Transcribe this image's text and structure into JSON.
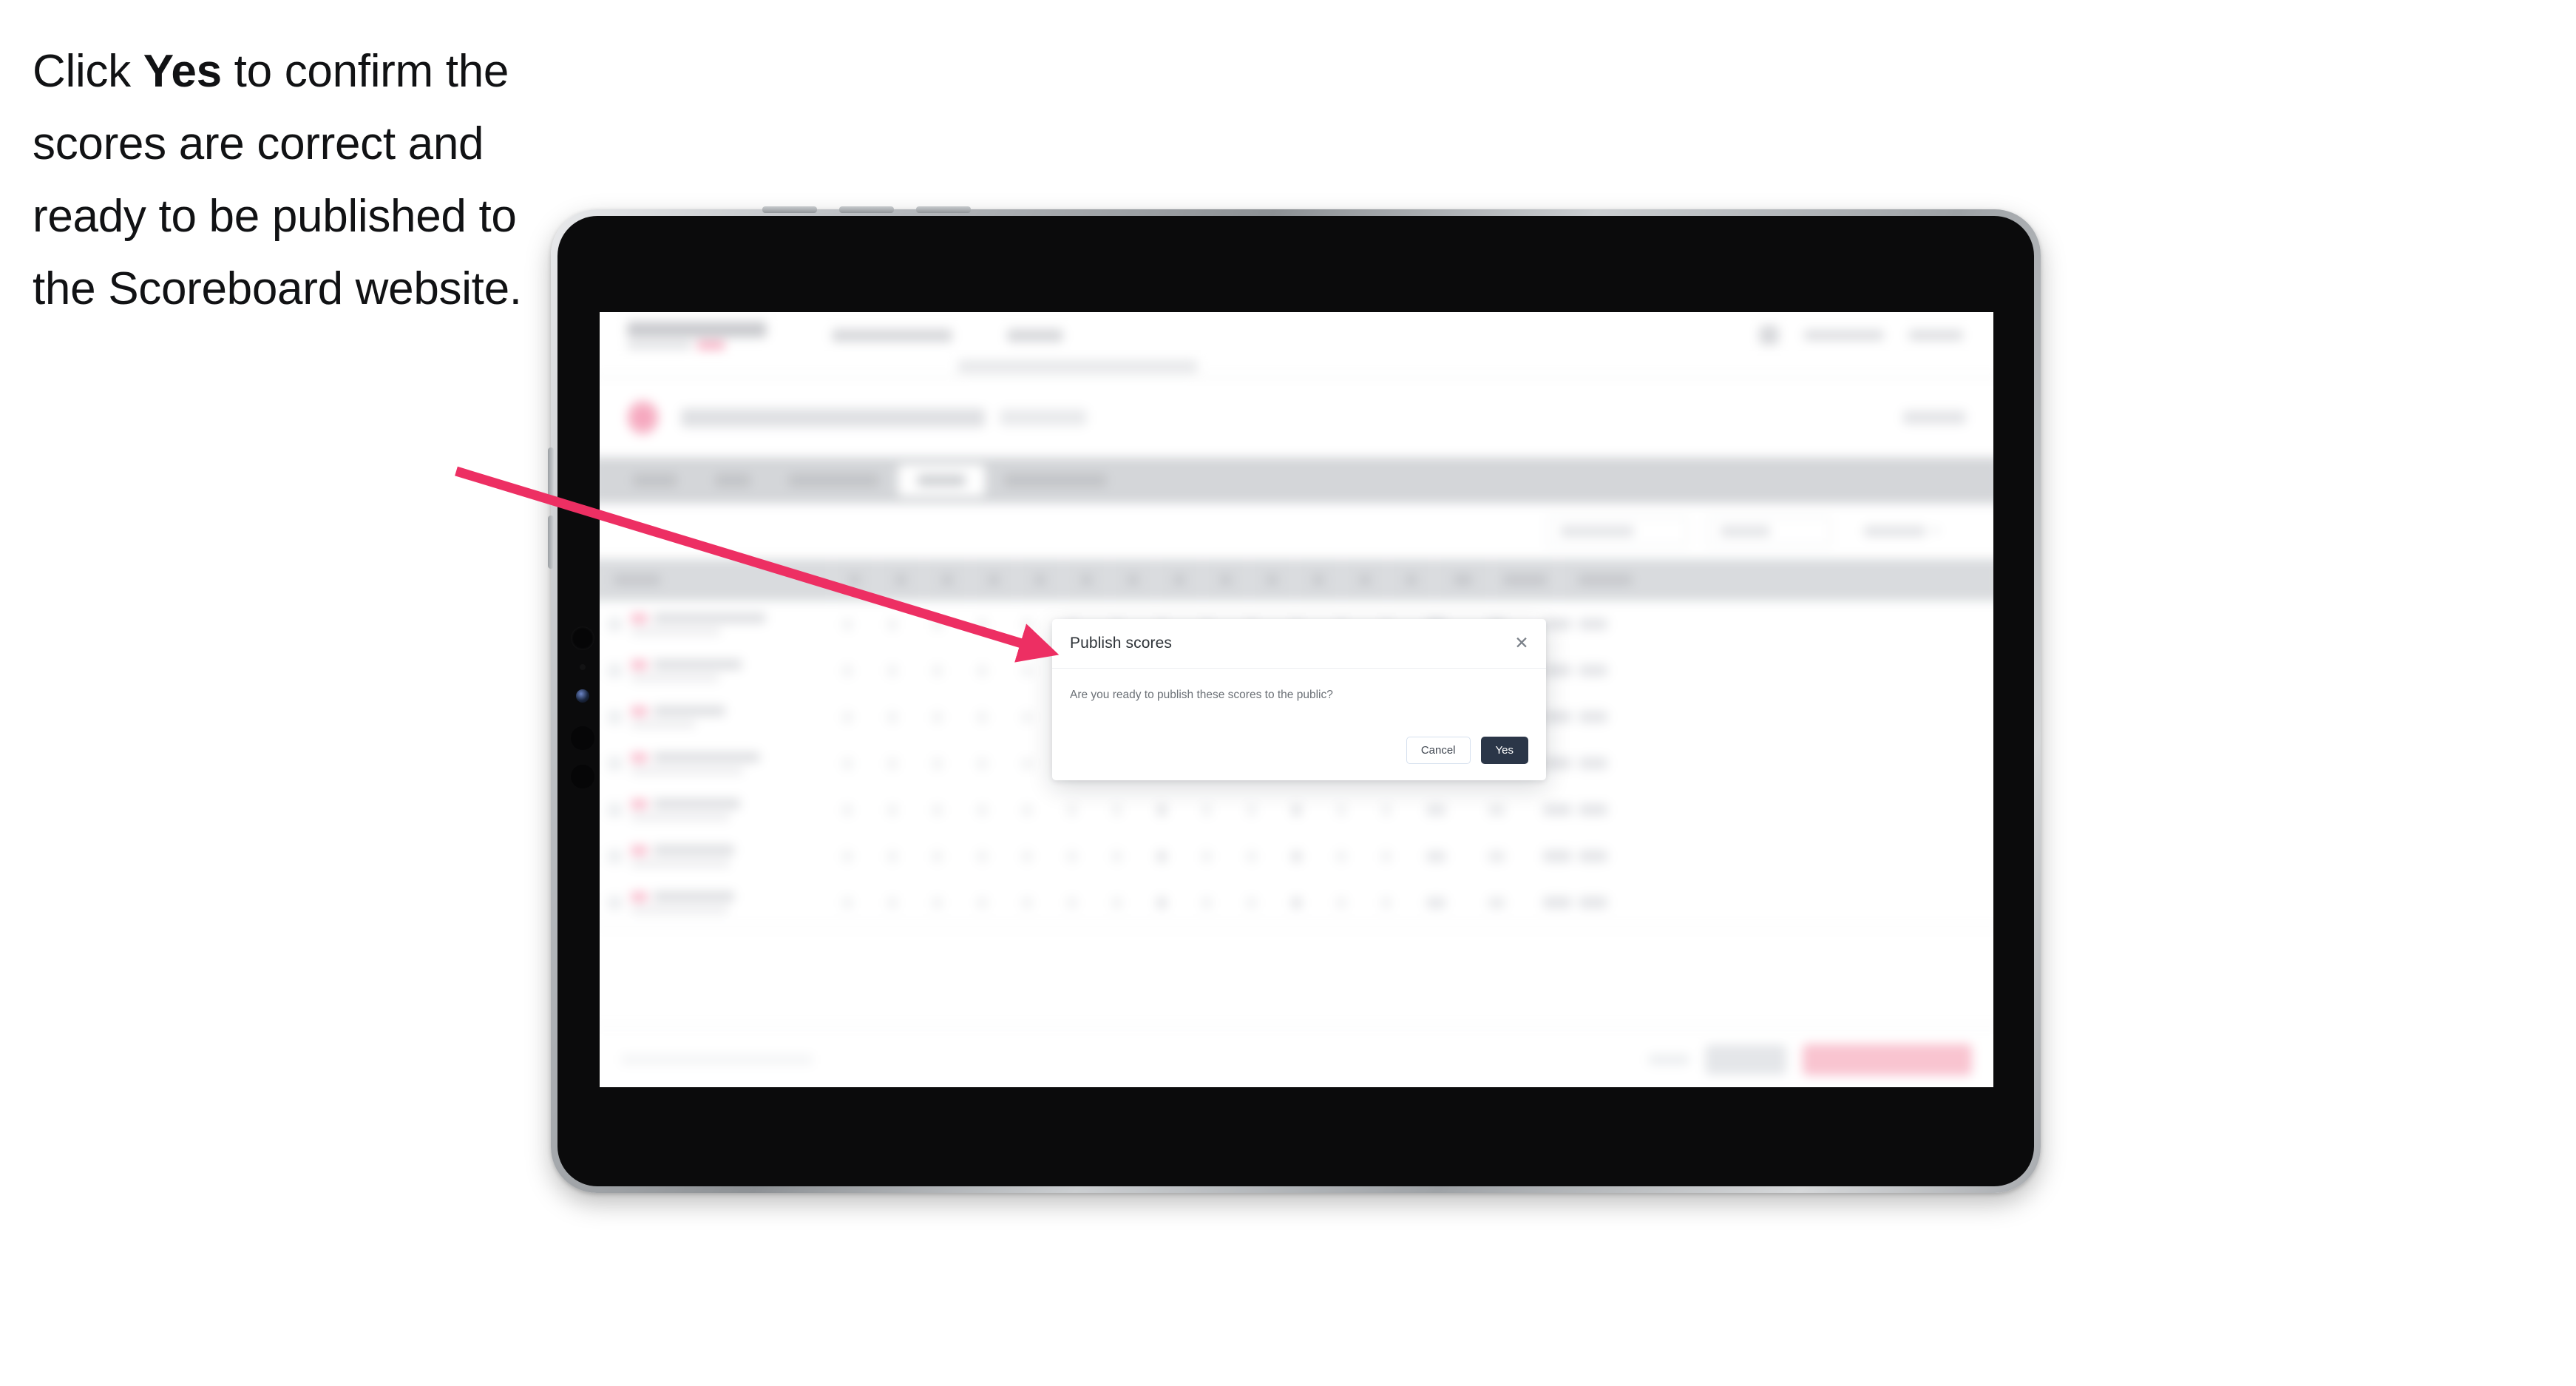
{
  "instruction": {
    "before": "Click ",
    "emphasis": "Yes",
    "after": " to confirm the scores are correct and ready to be published to the Scoreboard website."
  },
  "annotation": {
    "arrow_color": "#ED2F63",
    "arrow_name": "pointer-arrow"
  },
  "modal": {
    "title": "Publish scores",
    "close_icon": "close-icon",
    "close_glyph": "✕",
    "body": "Are you ready to publish these scores to the public?",
    "cancel_label": "Cancel",
    "confirm_label": "Yes",
    "confirm_color": "#2b3648",
    "cancel_border_color": "#d6e0ee"
  },
  "app": {
    "header": {
      "brand": "",
      "nav": [
        "",
        ""
      ],
      "right": [
        "",
        ""
      ],
      "icon": "bell-icon"
    },
    "title_row": {
      "logo": "team-logo",
      "title": "",
      "subtitle": "",
      "right": ""
    },
    "tabs": [
      {
        "label": "",
        "active": false
      },
      {
        "label": "",
        "active": false
      },
      {
        "label": "",
        "active": false
      },
      {
        "label": "",
        "active": true
      },
      {
        "label": "",
        "active": false
      }
    ],
    "filters": [
      {
        "name": "view-select",
        "label": ""
      },
      {
        "name": "round-select",
        "label": ""
      },
      {
        "name": "team-select",
        "label": ""
      }
    ],
    "table": {
      "columns": [
        "",
        "",
        "",
        "",
        "",
        "",
        "",
        "",
        "",
        "",
        "",
        "",
        "",
        "",
        "",
        "",
        "",
        ""
      ],
      "hole_count": 13,
      "rows": [
        {
          "name": "",
          "sub": ""
        },
        {
          "name": "",
          "sub": ""
        },
        {
          "name": "",
          "sub": ""
        },
        {
          "name": "",
          "sub": ""
        },
        {
          "name": "",
          "sub": ""
        },
        {
          "name": "",
          "sub": ""
        },
        {
          "name": "",
          "sub": ""
        }
      ]
    },
    "action_bar": {
      "note": "",
      "link": "",
      "secondary_button": "",
      "primary_button": "",
      "primary_color": "#f9c3d0"
    }
  },
  "device": {
    "type": "tablet",
    "frame_color": "#0b0b0c",
    "bezel_color": "#b9bcc0"
  }
}
